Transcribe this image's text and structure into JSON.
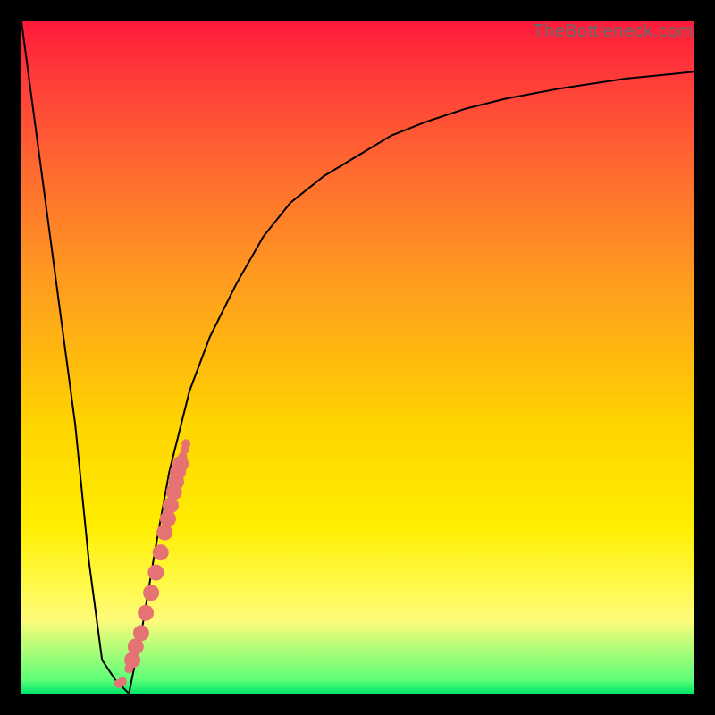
{
  "watermark": "TheBottleneck.com",
  "colors": {
    "frame": "#000000",
    "curve": "#000000",
    "dot": "#e57373",
    "gradient_top": "#ff1a3a",
    "gradient_bottom": "#00e56a"
  },
  "chart_data": {
    "type": "line",
    "title": "",
    "xlabel": "",
    "ylabel": "",
    "xlim": [
      0,
      100
    ],
    "ylim": [
      0,
      100
    ],
    "grid": false,
    "legend": false,
    "series": [
      {
        "name": "bottleneck-curve",
        "x": [
          0,
          2,
          4,
          6,
          8,
          10,
          12,
          14,
          16,
          18,
          20,
          22,
          25,
          28,
          32,
          36,
          40,
          45,
          50,
          55,
          60,
          66,
          72,
          80,
          90,
          100
        ],
        "y": [
          100,
          85,
          70,
          55,
          40,
          20,
          5,
          2,
          0,
          10,
          22,
          33,
          45,
          53,
          61,
          68,
          73,
          77,
          80,
          83,
          85,
          87,
          88.5,
          90,
          91.5,
          92.5
        ]
      }
    ],
    "scatter": [
      {
        "name": "highlight-cluster",
        "x": [
          14.5,
          15.0,
          16.0,
          16.5,
          17.0,
          17.8,
          18.5,
          19.3,
          20.0,
          20.7,
          21.3,
          21.8,
          22.2,
          22.7,
          23.0,
          23.3,
          23.7,
          24.0,
          24.3,
          24.5
        ],
        "y": [
          1.5,
          1.8,
          3.7,
          5.0,
          7.0,
          9.0,
          12.0,
          15.0,
          18.0,
          21.0,
          24.0,
          26.0,
          28.0,
          30.0,
          31.5,
          33.0,
          34.2,
          35.3,
          36.3,
          37.2
        ]
      }
    ]
  }
}
